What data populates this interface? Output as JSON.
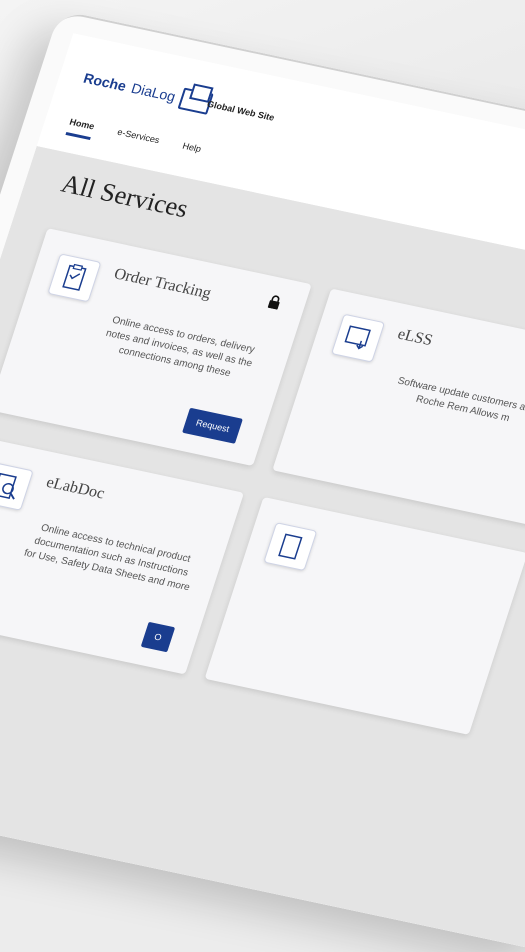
{
  "header": {
    "brand": "Roche",
    "brand_sub": "DiaLog",
    "site_name": "Global Web Site"
  },
  "nav": {
    "items": [
      "Home",
      "e-Services",
      "Help"
    ]
  },
  "main": {
    "title": "All Services",
    "cards": [
      {
        "title": "Order Tracking",
        "desc": "Online access to orders, delivery notes and invoices, as well as the connections among these",
        "button": "Request",
        "locked": true
      },
      {
        "title": "eLSS",
        "desc": "Software update customers and Roche Rem Allows m",
        "button": "",
        "locked": false
      },
      {
        "title": "eLabDoc",
        "desc": "Online access to technical product documentation such as Instructions for Use, Safety Data Sheets and more",
        "button": "O",
        "locked": false
      },
      {
        "title": "",
        "desc": "",
        "button": "",
        "locked": false
      }
    ]
  },
  "colors": {
    "brand_blue": "#1a3d8f",
    "content_bg": "#e4e4e4",
    "card_bg": "#f6f6f8"
  }
}
